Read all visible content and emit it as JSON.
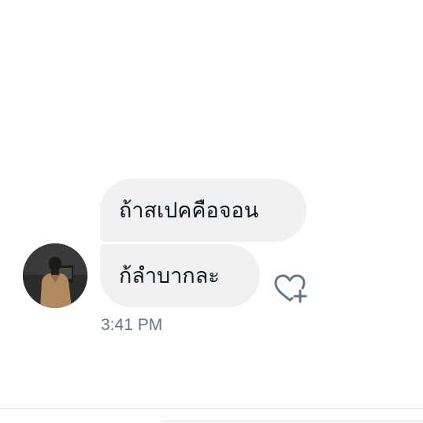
{
  "conversation": {
    "sender": {
      "avatar_icon": "user-photo-avatar"
    },
    "messages": [
      {
        "text": "ถ้าสเปคคือจอน"
      },
      {
        "text": "ก้ลำบากละ"
      }
    ],
    "timestamp": "3:41 PM",
    "reaction_icon": "heart-plus-icon"
  },
  "colors": {
    "bubble_background": "#eff1f3",
    "message_text": "#14171a",
    "timestamp_text": "#657786",
    "icon_stroke": "#657786"
  }
}
